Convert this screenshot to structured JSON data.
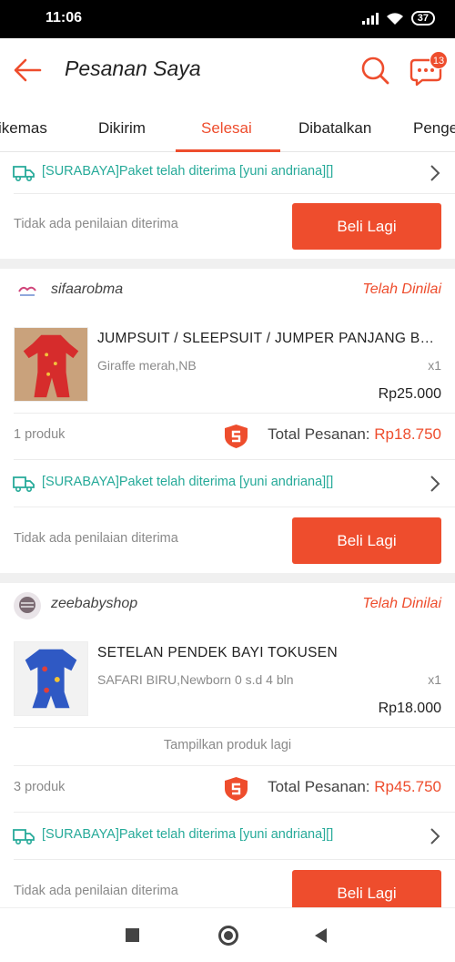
{
  "status_bar": {
    "time": "11:06",
    "battery": "37"
  },
  "header": {
    "title": "Pesanan Saya",
    "chat_badge": "13"
  },
  "tabs": [
    {
      "label": "ikemas"
    },
    {
      "label": "Dikirim"
    },
    {
      "label": "Selesai",
      "active": true
    },
    {
      "label": "Dibatalkan"
    },
    {
      "label": "Penge"
    }
  ],
  "orders": [
    {
      "shipping": "[SURABAYA]Paket telah diterima [yuni andriana][]",
      "review": "Tidak ada penilaian diterima",
      "buy_again": "Beli Lagi"
    },
    {
      "shop_name": "sifaarobma",
      "status": "Telah Dinilai",
      "product": {
        "name": "JUMPSUIT / SLEEPSUIT / JUMPER PANJANG BAYI MOTIF",
        "variant": "Giraffe merah,NB",
        "qty": "x1",
        "price": "Rp25.000"
      },
      "count": "1 produk",
      "total_label": "Total Pesanan: ",
      "total_amount": "Rp18.750",
      "shipping": "[SURABAYA]Paket telah diterima [yuni andriana][]",
      "review": "Tidak ada penilaian diterima",
      "buy_again": "Beli Lagi"
    },
    {
      "shop_name": "zeebabyshop",
      "status": "Telah Dinilai",
      "product": {
        "name": "SETELAN PENDEK BAYI TOKUSEN",
        "variant": "SAFARI BIRU,Newborn 0 s.d 4 bln",
        "qty": "x1",
        "price": "Rp18.000"
      },
      "more_products": "Tampilkan produk lagi",
      "count": "3 produk",
      "total_label": "Total Pesanan: ",
      "total_amount": "Rp45.750",
      "shipping": "[SURABAYA]Paket telah diterima [yuni andriana][]",
      "review": "Tidak ada penilaian diterima",
      "buy_again": "Beli Lagi"
    }
  ],
  "colors": {
    "accent": "#ee4d2d",
    "shipping": "#26aa99",
    "muted": "#8a8a8a"
  }
}
